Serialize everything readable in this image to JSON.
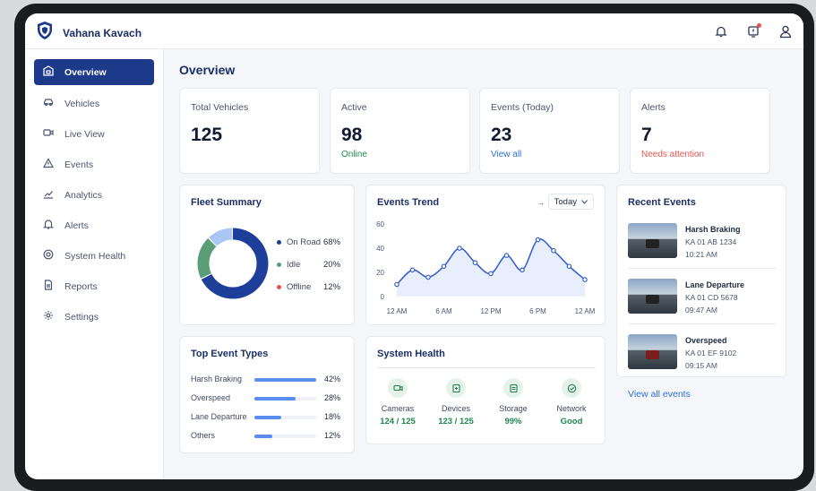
{
  "app": {
    "name": "Vahana Kavach"
  },
  "sidebar": {
    "items": [
      {
        "label": "Overview",
        "icon": "overview-icon",
        "active": true
      },
      {
        "label": "Vehicles",
        "icon": "car-icon"
      },
      {
        "label": "Live View",
        "icon": "video-icon"
      },
      {
        "label": "Events",
        "icon": "warning-icon"
      },
      {
        "label": "Analytics",
        "icon": "analytics-icon"
      },
      {
        "label": "Alerts",
        "icon": "bell-icon"
      },
      {
        "label": "System Health",
        "icon": "health-icon"
      },
      {
        "label": "Reports",
        "icon": "report-icon"
      },
      {
        "label": "Settings",
        "icon": "gear-icon"
      }
    ]
  },
  "page": {
    "title": "Overview"
  },
  "stats": [
    {
      "label": "Total Vehicles",
      "value": "125",
      "sub": "",
      "sub_color": "#4a5570"
    },
    {
      "label": "Active",
      "value": "98",
      "sub": "Online",
      "sub_color": "#1e8a4c"
    },
    {
      "label": "Events (Today)",
      "value": "23",
      "sub": "View all",
      "sub_color": "#2f6fd8"
    },
    {
      "label": "Alerts",
      "value": "7",
      "sub": "Needs attention",
      "sub_color": "#e4554f"
    }
  ],
  "fleet": {
    "title": "Fleet Summary",
    "legend": [
      {
        "label": "On Road",
        "pct": "68%",
        "value": 68,
        "color": "#1d3f9a"
      },
      {
        "label": "Idle",
        "pct": "20%",
        "value": 20,
        "color": "#5a9e78"
      },
      {
        "label": "Offline",
        "pct": "12%",
        "value": 12,
        "color": "#e4554f"
      }
    ]
  },
  "trend": {
    "title": "Events Trend",
    "range": "Today"
  },
  "chart_data": {
    "type": "line",
    "title": "Events Trend",
    "xlabel": "",
    "ylabel": "",
    "x_tick_labels": [
      "12 AM",
      "6 AM",
      "12 PM",
      "6 PM",
      "12 AM"
    ],
    "y_ticks": [
      0,
      20,
      40,
      60
    ],
    "ylim": [
      0,
      60
    ],
    "grid": false,
    "series": [
      {
        "hours": [
          0,
          2,
          4,
          6,
          8,
          10,
          12,
          14,
          16,
          18,
          20,
          22,
          24
        ],
        "values": [
          10,
          22,
          16,
          25,
          40,
          28,
          19,
          34,
          22,
          47,
          38,
          25,
          14
        ],
        "color": "#3a62c9"
      }
    ]
  },
  "recent": {
    "title": "Recent Events",
    "items": [
      {
        "title": "Harsh Braking",
        "plate": "KA 01 AB 1234",
        "time": "10:21 AM"
      },
      {
        "title": "Lane Departure",
        "plate": "KA 01 CD 5678",
        "time": "09:47 AM"
      },
      {
        "title": "Overspeed",
        "plate": "KA 01 EF 9102",
        "time": "09:15 AM"
      }
    ],
    "link": "View all events"
  },
  "top_events": {
    "title": "Top Event Types",
    "items": [
      {
        "label": "Harsh Braking",
        "pct": "42%",
        "value": 42
      },
      {
        "label": "Overspeed",
        "pct": "28%",
        "value": 28
      },
      {
        "label": "Lane Departure",
        "pct": "18%",
        "value": 18
      },
      {
        "label": "Others",
        "pct": "12%",
        "value": 12
      }
    ]
  },
  "health": {
    "title": "System Health",
    "items": [
      {
        "name": "Cameras",
        "value": "124 / 125",
        "icon": "camera-icon"
      },
      {
        "name": "Devices",
        "value": "123 / 125",
        "icon": "device-icon"
      },
      {
        "name": "Storage",
        "value": "99%",
        "icon": "storage-icon"
      },
      {
        "name": "Network",
        "value": "Good",
        "icon": "network-icon"
      }
    ]
  },
  "colors": {
    "accent": "#1d3a8a",
    "success": "#1e8a4c",
    "danger": "#e4554f",
    "link": "#2f6fd8",
    "bar": "#5b8def"
  }
}
